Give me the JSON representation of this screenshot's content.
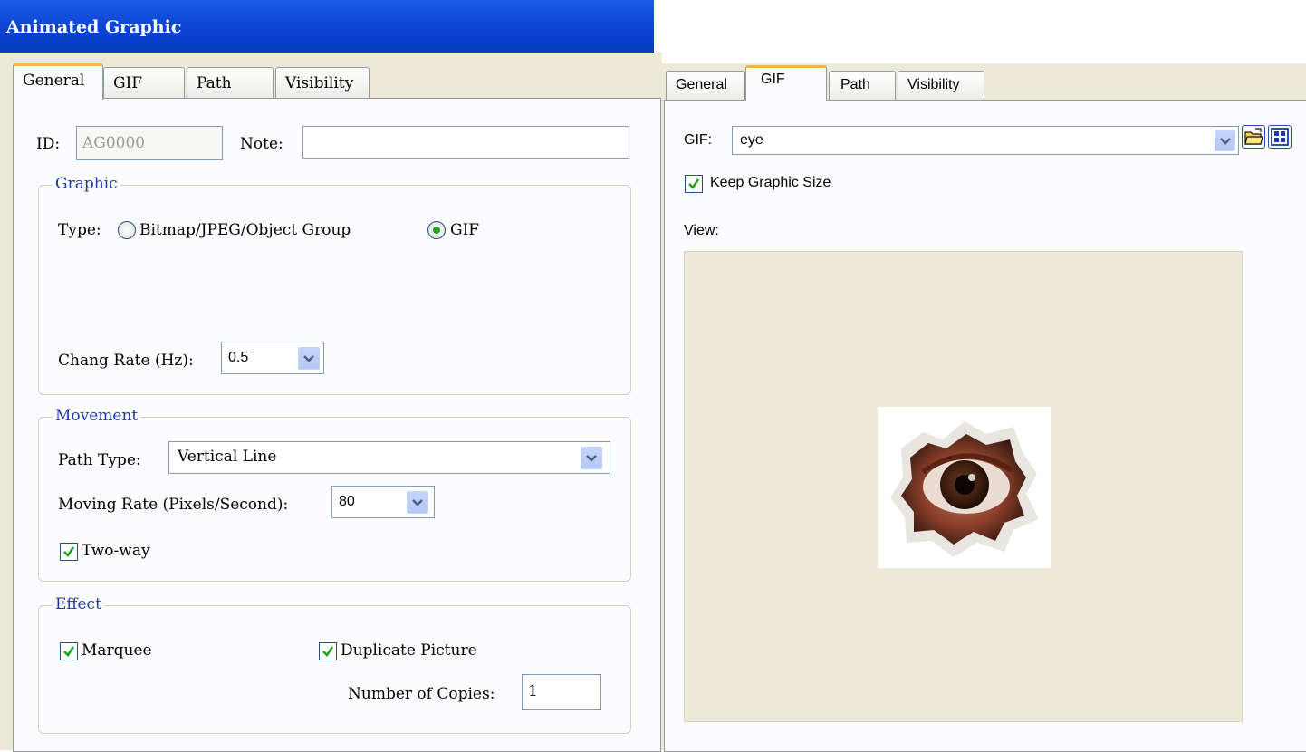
{
  "window": {
    "title": "Animated Graphic"
  },
  "left": {
    "tabs": [
      "General",
      "GIF",
      "Path",
      "Visibility"
    ],
    "active_tab": "General",
    "id_label": "ID:",
    "id_value": "AG0000",
    "note_label": "Note:",
    "note_value": "",
    "graphic": {
      "legend": "Graphic",
      "type_label": "Type:",
      "option_bitmap": "Bitmap/JPEG/Object Group",
      "option_gif": "GIF",
      "selected": "GIF",
      "rate_label": "Chang Rate (Hz):",
      "rate_value": "0.5"
    },
    "movement": {
      "legend": "Movement",
      "path_type_label": "Path Type:",
      "path_type_value": "Vertical Line",
      "moving_rate_label": "Moving Rate (Pixels/Second):",
      "moving_rate_value": "80",
      "two_way_label": "Two-way",
      "two_way_checked": true
    },
    "effect": {
      "legend": "Effect",
      "marquee_label": "Marquee",
      "marquee_checked": true,
      "duplicate_label": "Duplicate Picture",
      "duplicate_checked": true,
      "copies_label": "Number of Copies:",
      "copies_value": "1"
    }
  },
  "right": {
    "tabs": [
      "General",
      "GIF",
      "Path",
      "Visibility"
    ],
    "active_tab": "GIF",
    "gif_label": "GIF:",
    "gif_value": "eye",
    "keep_size_label": "Keep Graphic Size",
    "keep_size_checked": true,
    "view_label": "View:",
    "preview_icon": "eye-image"
  },
  "colors": {
    "titlebar": "#0a43d4",
    "dialog_bg": "#ece9d8",
    "panel_bg": "#fcfcfe",
    "legend_text": "#1c3aa8",
    "active_tab_accent": "#f7b64b",
    "check_mark": "#21a121"
  }
}
